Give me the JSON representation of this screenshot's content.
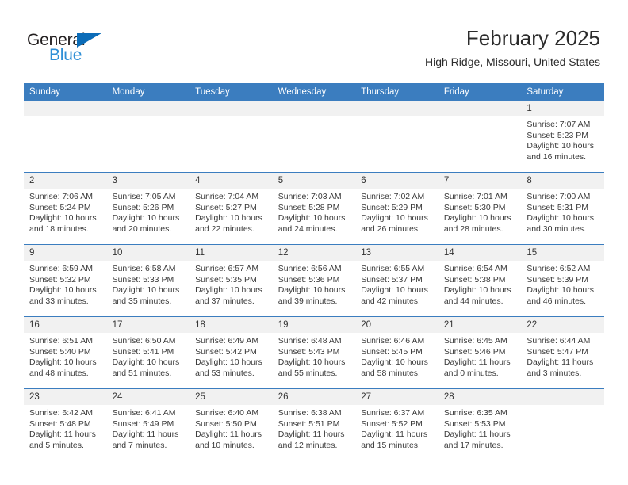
{
  "brand": {
    "name_top": "General",
    "name_bottom": "Blue",
    "triangle_color": "#0b6cb8",
    "text_color_top": "#231f20",
    "text_color_bottom": "#2f8fd6"
  },
  "header": {
    "title": "February 2025",
    "subtitle": "High Ridge, Missouri, United States"
  },
  "colors": {
    "header_row_background": "#3b7dbf",
    "header_row_text": "#ffffff",
    "daynum_background": "#f1f1f1",
    "body_text": "#3a3a3a",
    "grid_line": "#3b7dbf"
  },
  "weekday_headers": [
    "Sunday",
    "Monday",
    "Tuesday",
    "Wednesday",
    "Thursday",
    "Friday",
    "Saturday"
  ],
  "weeks": [
    [
      {
        "day": "",
        "empty": true,
        "sunrise": "",
        "sunset": "",
        "daylight_line1": "",
        "daylight_line2": ""
      },
      {
        "day": "",
        "empty": true,
        "sunrise": "",
        "sunset": "",
        "daylight_line1": "",
        "daylight_line2": ""
      },
      {
        "day": "",
        "empty": true,
        "sunrise": "",
        "sunset": "",
        "daylight_line1": "",
        "daylight_line2": ""
      },
      {
        "day": "",
        "empty": true,
        "sunrise": "",
        "sunset": "",
        "daylight_line1": "",
        "daylight_line2": ""
      },
      {
        "day": "",
        "empty": true,
        "sunrise": "",
        "sunset": "",
        "daylight_line1": "",
        "daylight_line2": ""
      },
      {
        "day": "",
        "empty": true,
        "sunrise": "",
        "sunset": "",
        "daylight_line1": "",
        "daylight_line2": ""
      },
      {
        "day": "1",
        "empty": false,
        "sunrise": "Sunrise: 7:07 AM",
        "sunset": "Sunset: 5:23 PM",
        "daylight_line1": "Daylight: 10 hours",
        "daylight_line2": "and 16 minutes."
      }
    ],
    [
      {
        "day": "2",
        "empty": false,
        "sunrise": "Sunrise: 7:06 AM",
        "sunset": "Sunset: 5:24 PM",
        "daylight_line1": "Daylight: 10 hours",
        "daylight_line2": "and 18 minutes."
      },
      {
        "day": "3",
        "empty": false,
        "sunrise": "Sunrise: 7:05 AM",
        "sunset": "Sunset: 5:26 PM",
        "daylight_line1": "Daylight: 10 hours",
        "daylight_line2": "and 20 minutes."
      },
      {
        "day": "4",
        "empty": false,
        "sunrise": "Sunrise: 7:04 AM",
        "sunset": "Sunset: 5:27 PM",
        "daylight_line1": "Daylight: 10 hours",
        "daylight_line2": "and 22 minutes."
      },
      {
        "day": "5",
        "empty": false,
        "sunrise": "Sunrise: 7:03 AM",
        "sunset": "Sunset: 5:28 PM",
        "daylight_line1": "Daylight: 10 hours",
        "daylight_line2": "and 24 minutes."
      },
      {
        "day": "6",
        "empty": false,
        "sunrise": "Sunrise: 7:02 AM",
        "sunset": "Sunset: 5:29 PM",
        "daylight_line1": "Daylight: 10 hours",
        "daylight_line2": "and 26 minutes."
      },
      {
        "day": "7",
        "empty": false,
        "sunrise": "Sunrise: 7:01 AM",
        "sunset": "Sunset: 5:30 PM",
        "daylight_line1": "Daylight: 10 hours",
        "daylight_line2": "and 28 minutes."
      },
      {
        "day": "8",
        "empty": false,
        "sunrise": "Sunrise: 7:00 AM",
        "sunset": "Sunset: 5:31 PM",
        "daylight_line1": "Daylight: 10 hours",
        "daylight_line2": "and 30 minutes."
      }
    ],
    [
      {
        "day": "9",
        "empty": false,
        "sunrise": "Sunrise: 6:59 AM",
        "sunset": "Sunset: 5:32 PM",
        "daylight_line1": "Daylight: 10 hours",
        "daylight_line2": "and 33 minutes."
      },
      {
        "day": "10",
        "empty": false,
        "sunrise": "Sunrise: 6:58 AM",
        "sunset": "Sunset: 5:33 PM",
        "daylight_line1": "Daylight: 10 hours",
        "daylight_line2": "and 35 minutes."
      },
      {
        "day": "11",
        "empty": false,
        "sunrise": "Sunrise: 6:57 AM",
        "sunset": "Sunset: 5:35 PM",
        "daylight_line1": "Daylight: 10 hours",
        "daylight_line2": "and 37 minutes."
      },
      {
        "day": "12",
        "empty": false,
        "sunrise": "Sunrise: 6:56 AM",
        "sunset": "Sunset: 5:36 PM",
        "daylight_line1": "Daylight: 10 hours",
        "daylight_line2": "and 39 minutes."
      },
      {
        "day": "13",
        "empty": false,
        "sunrise": "Sunrise: 6:55 AM",
        "sunset": "Sunset: 5:37 PM",
        "daylight_line1": "Daylight: 10 hours",
        "daylight_line2": "and 42 minutes."
      },
      {
        "day": "14",
        "empty": false,
        "sunrise": "Sunrise: 6:54 AM",
        "sunset": "Sunset: 5:38 PM",
        "daylight_line1": "Daylight: 10 hours",
        "daylight_line2": "and 44 minutes."
      },
      {
        "day": "15",
        "empty": false,
        "sunrise": "Sunrise: 6:52 AM",
        "sunset": "Sunset: 5:39 PM",
        "daylight_line1": "Daylight: 10 hours",
        "daylight_line2": "and 46 minutes."
      }
    ],
    [
      {
        "day": "16",
        "empty": false,
        "sunrise": "Sunrise: 6:51 AM",
        "sunset": "Sunset: 5:40 PM",
        "daylight_line1": "Daylight: 10 hours",
        "daylight_line2": "and 48 minutes."
      },
      {
        "day": "17",
        "empty": false,
        "sunrise": "Sunrise: 6:50 AM",
        "sunset": "Sunset: 5:41 PM",
        "daylight_line1": "Daylight: 10 hours",
        "daylight_line2": "and 51 minutes."
      },
      {
        "day": "18",
        "empty": false,
        "sunrise": "Sunrise: 6:49 AM",
        "sunset": "Sunset: 5:42 PM",
        "daylight_line1": "Daylight: 10 hours",
        "daylight_line2": "and 53 minutes."
      },
      {
        "day": "19",
        "empty": false,
        "sunrise": "Sunrise: 6:48 AM",
        "sunset": "Sunset: 5:43 PM",
        "daylight_line1": "Daylight: 10 hours",
        "daylight_line2": "and 55 minutes."
      },
      {
        "day": "20",
        "empty": false,
        "sunrise": "Sunrise: 6:46 AM",
        "sunset": "Sunset: 5:45 PM",
        "daylight_line1": "Daylight: 10 hours",
        "daylight_line2": "and 58 minutes."
      },
      {
        "day": "21",
        "empty": false,
        "sunrise": "Sunrise: 6:45 AM",
        "sunset": "Sunset: 5:46 PM",
        "daylight_line1": "Daylight: 11 hours",
        "daylight_line2": "and 0 minutes."
      },
      {
        "day": "22",
        "empty": false,
        "sunrise": "Sunrise: 6:44 AM",
        "sunset": "Sunset: 5:47 PM",
        "daylight_line1": "Daylight: 11 hours",
        "daylight_line2": "and 3 minutes."
      }
    ],
    [
      {
        "day": "23",
        "empty": false,
        "sunrise": "Sunrise: 6:42 AM",
        "sunset": "Sunset: 5:48 PM",
        "daylight_line1": "Daylight: 11 hours",
        "daylight_line2": "and 5 minutes."
      },
      {
        "day": "24",
        "empty": false,
        "sunrise": "Sunrise: 6:41 AM",
        "sunset": "Sunset: 5:49 PM",
        "daylight_line1": "Daylight: 11 hours",
        "daylight_line2": "and 7 minutes."
      },
      {
        "day": "25",
        "empty": false,
        "sunrise": "Sunrise: 6:40 AM",
        "sunset": "Sunset: 5:50 PM",
        "daylight_line1": "Daylight: 11 hours",
        "daylight_line2": "and 10 minutes."
      },
      {
        "day": "26",
        "empty": false,
        "sunrise": "Sunrise: 6:38 AM",
        "sunset": "Sunset: 5:51 PM",
        "daylight_line1": "Daylight: 11 hours",
        "daylight_line2": "and 12 minutes."
      },
      {
        "day": "27",
        "empty": false,
        "sunrise": "Sunrise: 6:37 AM",
        "sunset": "Sunset: 5:52 PM",
        "daylight_line1": "Daylight: 11 hours",
        "daylight_line2": "and 15 minutes."
      },
      {
        "day": "28",
        "empty": false,
        "sunrise": "Sunrise: 6:35 AM",
        "sunset": "Sunset: 5:53 PM",
        "daylight_line1": "Daylight: 11 hours",
        "daylight_line2": "and 17 minutes."
      },
      {
        "day": "",
        "empty": true,
        "sunrise": "",
        "sunset": "",
        "daylight_line1": "",
        "daylight_line2": ""
      }
    ]
  ]
}
